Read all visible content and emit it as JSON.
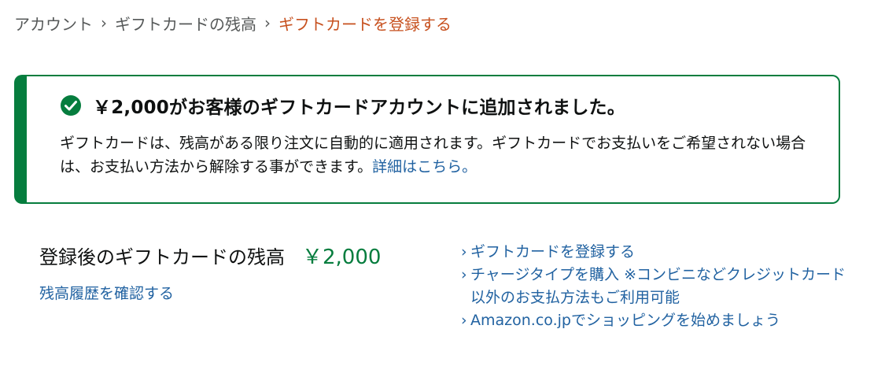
{
  "breadcrumb": {
    "items": [
      "アカウント",
      "ギフトカードの残高",
      "ギフトカードを登録する"
    ],
    "separator": "›"
  },
  "alert": {
    "icon": "check-circle-icon",
    "color": "#067d3e",
    "title": "￥2,000がお客様のギフトカードアカウントに追加されました。",
    "body": "ギフトカードは、残高がある限り注文に自動的に適用されます。ギフトカードでお支払いをご希望されない場合は、お支払い方法から解除する事ができます。",
    "link": "詳細はこちら。"
  },
  "balance": {
    "label": "登録後のギフトカードの残高",
    "amount": "￥2,000",
    "history_link": "残高履歴を確認する"
  },
  "links": {
    "caret": "›",
    "items": [
      "ギフトカードを登録する",
      "チャージタイプを購入 ※コンビニなどクレジットカード以外のお支払方法もご利用可能",
      "Amazon.co.jpでショッピングを始めましょう"
    ]
  },
  "colors": {
    "link": "#2162a1",
    "success": "#067d3e",
    "breadcrumb_current": "#c7511f"
  }
}
